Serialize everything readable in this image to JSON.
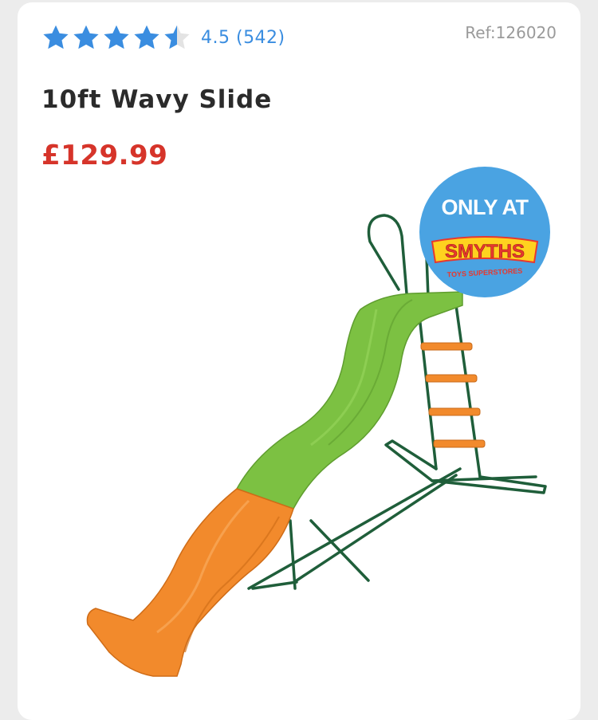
{
  "rating": {
    "value": 4.5,
    "stars_total": 5,
    "text": "4.5 (542)",
    "star_color": "#3a8de0",
    "star_empty_color": "#e3e3e3"
  },
  "product": {
    "ref": "Ref:126020",
    "title": "10ft Wavy Slide",
    "price": "£129.99",
    "price_color": "#d6342a"
  },
  "badge": {
    "top_text": "ONLY AT",
    "logo_text": "SMYTHS",
    "sub_text": "TOYS SUPERSTORES",
    "bg_color": "#4aa3e2"
  },
  "image": {
    "icon": "slide-product-image",
    "colors": {
      "slide_green": "#7cc142",
      "slide_orange": "#f28a2c",
      "frame_green": "#1f5e3a"
    }
  }
}
